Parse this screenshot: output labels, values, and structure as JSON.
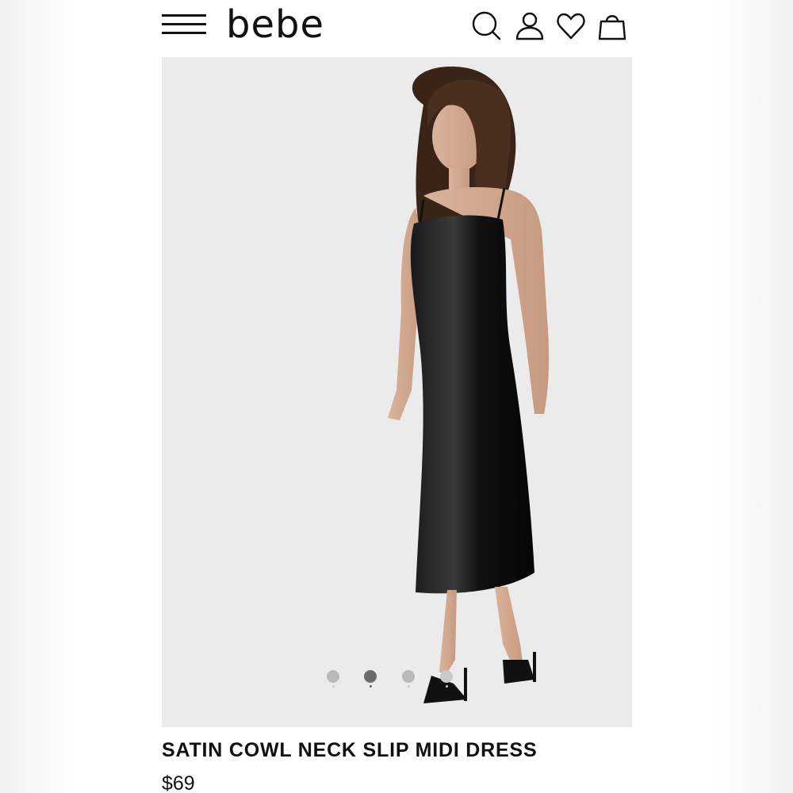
{
  "header": {
    "logo_text": "bebe",
    "icons": [
      "menu-icon",
      "search-icon",
      "account-icon",
      "heart-icon",
      "shopping-bag-icon"
    ]
  },
  "gallery": {
    "dots_count": 4,
    "active_index": 1
  },
  "product": {
    "title": "SATIN COWL NECK SLIP MIDI DRESS",
    "price": "$69"
  },
  "colors": {
    "background": "#ffffff",
    "text": "#111111",
    "dress": "#111111",
    "photo_bg": "#ebebeb",
    "dot_inactive": "#b9b9b9",
    "dot_active": "#6b6b6b"
  }
}
